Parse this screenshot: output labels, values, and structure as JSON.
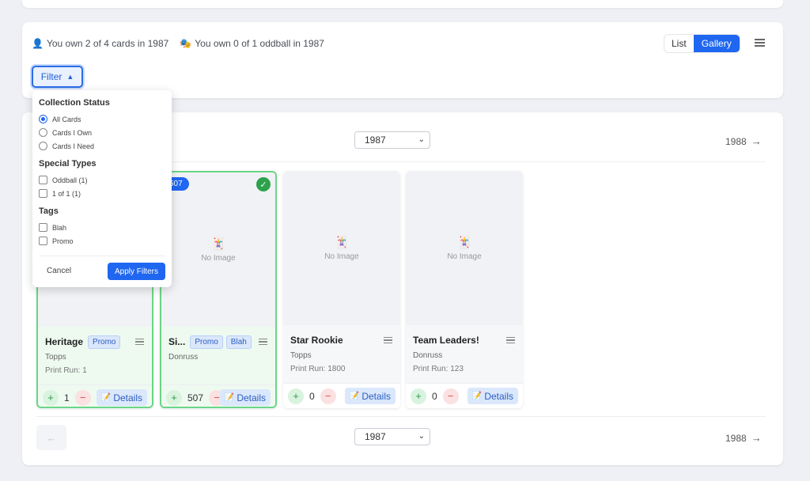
{
  "summary": {
    "owned_text": "You own 2 of 4 cards in 1987",
    "oddball_text": "You own 0 of 1 oddball in 1987"
  },
  "view_toggle": {
    "list": "List",
    "gallery": "Gallery",
    "active": "Gallery"
  },
  "filter": {
    "button_label": "Filter",
    "sections": {
      "status_title": "Collection Status",
      "status_options": [
        "All Cards",
        "Cards I Own",
        "Cards I Need"
      ],
      "special_title": "Special Types",
      "special_options": [
        "Oddball (1)",
        "1 of 1 (1)"
      ],
      "tags_title": "Tags",
      "tag_options": [
        "Blah",
        "Promo"
      ]
    },
    "cancel": "Cancel",
    "apply": "Apply Filters"
  },
  "pager": {
    "year": "1987",
    "next": "1988"
  },
  "no_image": "No Image",
  "details_label": "Details",
  "cards": [
    {
      "name": "Heritage",
      "tags": [
        "Promo"
      ],
      "maker": "Topps",
      "print_run": "Print Run: 1",
      "qty": "1",
      "owned": true,
      "badge": ""
    },
    {
      "name": "Si...",
      "tags": [
        "Promo",
        "Blah"
      ],
      "maker": "Donruss",
      "print_run": "",
      "qty": "507",
      "owned": true,
      "badge": "507"
    },
    {
      "name": "Star Rookie",
      "tags": [],
      "maker": "Topps",
      "print_run": "Print Run: 1800",
      "qty": "0",
      "owned": false,
      "badge": ""
    },
    {
      "name": "Team Leaders!",
      "tags": [],
      "maker": "Donruss",
      "print_run": "Print Run: 123",
      "qty": "0",
      "owned": false,
      "badge": ""
    }
  ],
  "colors": {
    "accent": "#1f66f0",
    "owned_border": "#6ad586",
    "owned_bg": "#eefaf0"
  }
}
